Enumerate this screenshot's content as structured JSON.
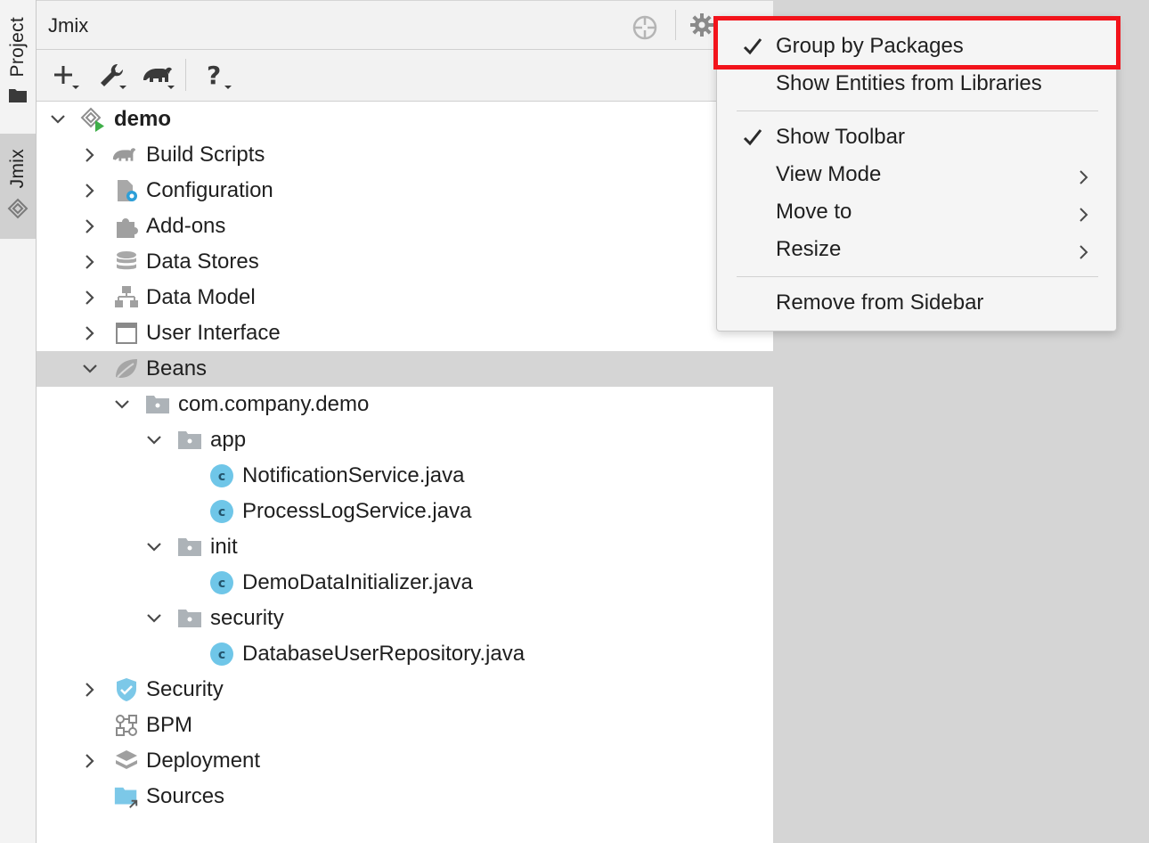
{
  "sidebar": {
    "tabs": [
      {
        "label": "Project",
        "icon": "folder-icon"
      },
      {
        "label": "Jmix",
        "icon": "jmix-logo-icon"
      }
    ]
  },
  "panel": {
    "title": "Jmix",
    "title_actions": [
      "locate-icon",
      "gear-icon"
    ],
    "toolbar": [
      "add-icon",
      "wrench-icon",
      "gradle-elephant-icon",
      "help-icon"
    ]
  },
  "tree": {
    "root": "demo",
    "items": [
      {
        "label": "Build Scripts",
        "icon": "gradle-elephant-icon"
      },
      {
        "label": "Configuration",
        "icon": "configuration-icon"
      },
      {
        "label": "Add-ons",
        "icon": "puzzle-icon"
      },
      {
        "label": "Data Stores",
        "icon": "database-icon"
      },
      {
        "label": "Data Model",
        "icon": "data-model-icon"
      },
      {
        "label": "User Interface",
        "icon": "window-icon"
      },
      {
        "label": "Beans",
        "icon": "spring-leaf-icon"
      },
      {
        "label": "com.company.demo",
        "icon": "package-icon"
      },
      {
        "label": "app",
        "icon": "package-icon"
      },
      {
        "label": "NotificationService.java",
        "icon": "class-icon"
      },
      {
        "label": "ProcessLogService.java",
        "icon": "class-icon"
      },
      {
        "label": "init",
        "icon": "package-icon"
      },
      {
        "label": "DemoDataInitializer.java",
        "icon": "class-icon"
      },
      {
        "label": "security",
        "icon": "package-icon"
      },
      {
        "label": "DatabaseUserRepository.java",
        "icon": "class-icon"
      },
      {
        "label": "Security",
        "icon": "shield-icon"
      },
      {
        "label": "BPM",
        "icon": "bpm-icon"
      },
      {
        "label": "Deployment",
        "icon": "layers-icon"
      },
      {
        "label": "Sources",
        "icon": "source-folder-icon"
      }
    ]
  },
  "menu": {
    "items": [
      {
        "label": "Group by Packages",
        "checked": true
      },
      {
        "label": "Show Entities from Libraries",
        "checked": false
      },
      {
        "label": "Show Toolbar",
        "checked": true
      },
      {
        "label": "View Mode",
        "submenu": true
      },
      {
        "label": "Move to",
        "submenu": true
      },
      {
        "label": "Resize",
        "submenu": true
      },
      {
        "label": "Remove from Sidebar"
      }
    ]
  },
  "colors": {
    "highlight_border": "#f2131b",
    "selection": "#d5d5d5",
    "class_icon": "#6fc6e8",
    "run_badge": "#3fae49",
    "shield": "#7cc8e8"
  }
}
